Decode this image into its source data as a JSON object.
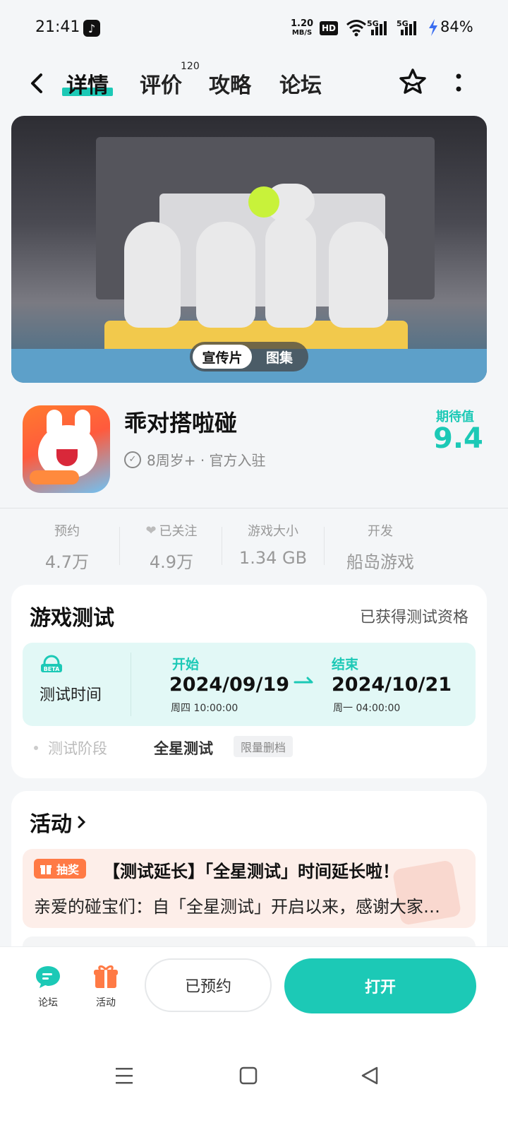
{
  "status_bar": {
    "time": "21:41",
    "net_speed_value": "1.20",
    "net_speed_unit": "MB/S",
    "hd_badge": "HD",
    "signal_1": "5G",
    "signal_2": "5G",
    "battery": "84%"
  },
  "nav": {
    "tabs": [
      {
        "label": "详情",
        "active": true
      },
      {
        "label": "评价",
        "count": "120"
      },
      {
        "label": "攻略"
      },
      {
        "label": "论坛"
      }
    ]
  },
  "banner": {
    "toggle_video": "宣传片",
    "toggle_gallery": "图集"
  },
  "app": {
    "title": "乖对搭啦碰",
    "subtitle": "8周岁+ · 官方入驻",
    "expect_label": "期待值",
    "expect_score": "9.4"
  },
  "stats": [
    {
      "label": "预约",
      "value": "4.7万"
    },
    {
      "label": "已关注",
      "value": "4.9万",
      "icon": "heart-icon"
    },
    {
      "label": "游戏大小",
      "value": "1.34 GB"
    },
    {
      "label": "开发",
      "value": "船岛游戏"
    }
  ],
  "test": {
    "title": "游戏测试",
    "qualification": "已获得测试资格",
    "beta_badge": "BETA",
    "time_label": "测试时间",
    "start_label": "开始",
    "start_date": "2024/09/19",
    "start_time": "周四 10:00:00",
    "end_label": "结束",
    "end_date": "2024/10/21",
    "end_time": "周一 04:00:00",
    "phase_label": "测试阶段",
    "phase_value": "全星测试",
    "phase_tag": "限量删档"
  },
  "activity": {
    "title": "活动",
    "item": {
      "tag": "抽奖",
      "headline": "【测试延长】「全星测试」时间延长啦！",
      "body": "亲爱的碰宝们：自「全星测试」开启以来，感谢大家的支持"
    }
  },
  "bottom_bar": {
    "forum": "论坛",
    "activity": "活动",
    "reserved": "已预约",
    "open": "打开"
  },
  "colors": {
    "accent": "#1cc9b6",
    "orange": "#ff7a45"
  }
}
